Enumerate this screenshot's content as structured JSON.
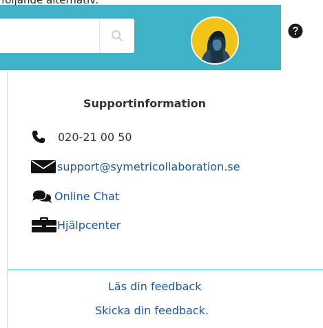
{
  "top_cut_text": "följande alternativ:",
  "search": {
    "placeholder": "",
    "button_icon": "search-icon"
  },
  "header": {
    "avatar_icon": "user-avatar",
    "help_icon": "question-circle-icon"
  },
  "colors": {
    "topbar": "#40b2c6",
    "link": "#1a58a6",
    "avatar_bg": "#f0c419"
  },
  "support": {
    "title": "Supportinformation",
    "phone": {
      "icon": "phone-icon",
      "text": "020-21 00 50"
    },
    "email": {
      "icon": "envelope-icon",
      "text": "support@symetricollaboration.se"
    },
    "chat": {
      "icon": "chat-icon",
      "text": "Online Chat"
    },
    "help_center": {
      "icon": "briefcase-icon",
      "text": "Hjälpcenter"
    }
  },
  "feedback": {
    "read_label": "Läs din feedback",
    "send_label": "Skicka din feedback."
  }
}
